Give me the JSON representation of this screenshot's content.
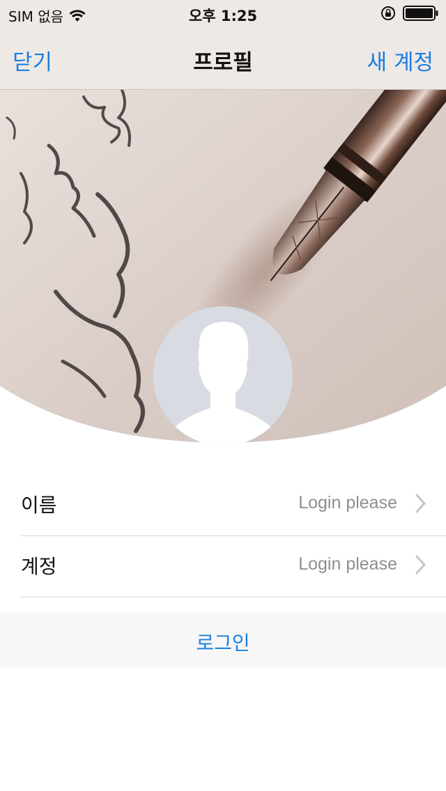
{
  "status_bar": {
    "carrier": "SIM 없음",
    "time": "오후 1:25",
    "icons": [
      "wifi-icon",
      "rotation-lock-icon",
      "battery-icon"
    ]
  },
  "nav": {
    "left_label": "닫기",
    "title": "프로필",
    "right_label": "새 계정"
  },
  "profile_rows": [
    {
      "label": "이름",
      "value": "Login please"
    },
    {
      "label": "계정",
      "value": "Login please"
    }
  ],
  "login_button": "로그인",
  "colors": {
    "accent": "#1a7fe0",
    "nav_background": "#efe9e6",
    "secondary_text": "#8e8e93",
    "avatar_background": "#d8dbe2"
  }
}
